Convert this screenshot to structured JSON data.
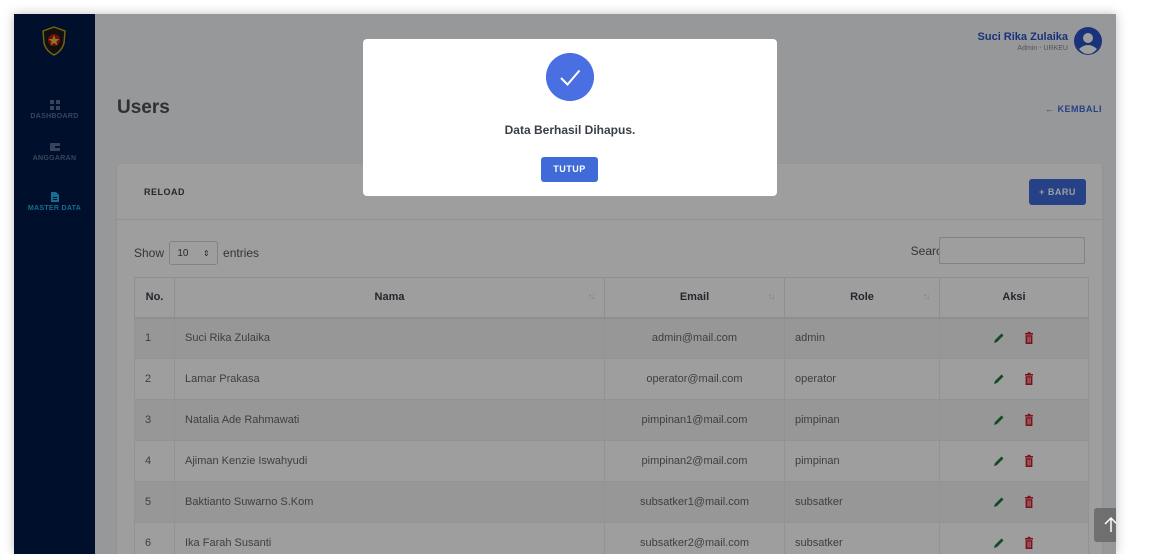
{
  "sidebar": {
    "items": [
      {
        "label": "DASHBOARD",
        "icon": "grid-icon"
      },
      {
        "label": "ANGGARAN",
        "icon": "wallet-icon"
      },
      {
        "label": "MASTER DATA",
        "icon": "document-icon"
      }
    ]
  },
  "user": {
    "name": "Suci Rika Zulaika",
    "role": "Admin - URKEU"
  },
  "page": {
    "title": "Users",
    "back_label": "← KEMBALI"
  },
  "toolbar": {
    "reload_label": "RELOAD",
    "new_label": "+ BARU"
  },
  "table": {
    "show_label": "Show",
    "entries_label": "entries",
    "page_length": "10",
    "search_label": "Search:",
    "search_value": "",
    "columns": [
      "No.",
      "Nama",
      "Email",
      "Role",
      "Aksi"
    ],
    "rows": [
      {
        "no": "1",
        "nama": "Suci Rika Zulaika",
        "email": "admin@mail.com",
        "role": "admin"
      },
      {
        "no": "2",
        "nama": "Lamar Prakasa",
        "email": "operator@mail.com",
        "role": "operator"
      },
      {
        "no": "3",
        "nama": "Natalia Ade Rahmawati",
        "email": "pimpinan1@mail.com",
        "role": "pimpinan"
      },
      {
        "no": "4",
        "nama": "Ajiman Kenzie Iswahyudi",
        "email": "pimpinan2@mail.com",
        "role": "pimpinan"
      },
      {
        "no": "5",
        "nama": "Baktianto Suwarno S.Kom",
        "email": "subsatker1@mail.com",
        "role": "subsatker"
      },
      {
        "no": "6",
        "nama": "Ika Farah Susanti",
        "email": "subsatker2@mail.com",
        "role": "subsatker"
      }
    ]
  },
  "modal": {
    "message": "Data Berhasil Dihapus.",
    "close_label": "TUTUP"
  },
  "colors": {
    "sidebar_bg": "#001b47",
    "accent": "#3f6ad8",
    "edit_icon": "#1a7a3c",
    "delete_icon": "#d11a2a"
  }
}
